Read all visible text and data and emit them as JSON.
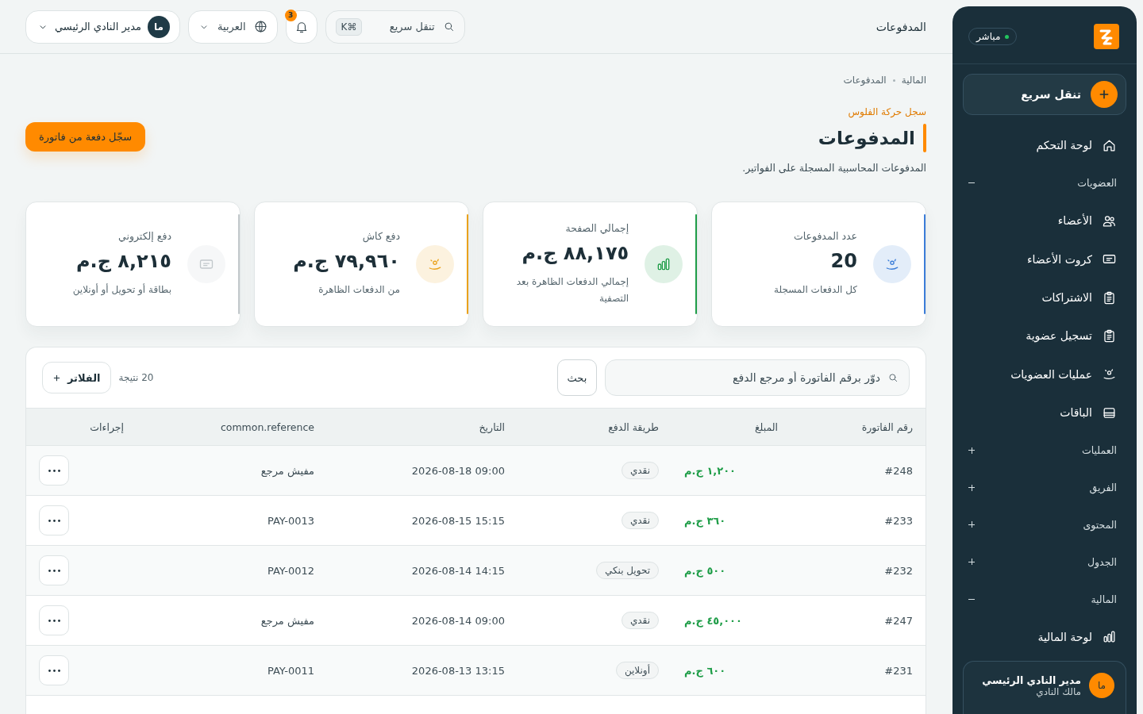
{
  "sidebar": {
    "live_label": "مباشر",
    "quick_nav": "تنقل سريع",
    "nav": [
      {
        "kind": "link",
        "label": "لوحة التحكم"
      },
      {
        "kind": "section",
        "label": "العضويات",
        "expanded": true,
        "children": [
          {
            "kind": "link",
            "label": "الأعضاء"
          },
          {
            "kind": "link",
            "label": "كروت الأعضاء"
          },
          {
            "kind": "link",
            "label": "الاشتراكات"
          },
          {
            "kind": "link",
            "label": "تسجيل عضوية"
          },
          {
            "kind": "link",
            "label": "عمليات العضويات"
          },
          {
            "kind": "link",
            "label": "الباقات"
          }
        ]
      },
      {
        "kind": "section",
        "label": "العمليات",
        "expanded": false
      },
      {
        "kind": "section",
        "label": "الفريق",
        "expanded": false
      },
      {
        "kind": "section",
        "label": "المحتوى",
        "expanded": false
      },
      {
        "kind": "section",
        "label": "الجدول",
        "expanded": false
      },
      {
        "kind": "section",
        "label": "المالية",
        "expanded": true,
        "children": [
          {
            "kind": "link",
            "label": "لوحة المالية"
          }
        ]
      }
    ],
    "user": {
      "avatar": "ما",
      "name": "مدير النادي الرئيسي",
      "role": "مالك النادي"
    }
  },
  "topbar": {
    "title": "المدفوعات",
    "quick_nav": "تنقل سريع",
    "shortcut": "⌘K",
    "notification_count": "3",
    "language": "العربية",
    "user": {
      "avatar": "ما",
      "name": "مدير النادي الرئيسي"
    }
  },
  "header": {
    "breadcrumb": [
      "المالية",
      "المدفوعات"
    ],
    "eyebrow": "سجل حركة الفلوس",
    "title": "المدفوعات",
    "description": "المدفوعات المحاسبية المسجلة على الفواتير.",
    "action": "سجّل دفعة من فاتورة"
  },
  "stats": [
    {
      "label": "عدد المدفوعات",
      "value": "20",
      "note": "كل الدفعات المسجلة",
      "color": "#3b7dd8"
    },
    {
      "label": "إجمالي الصفحة",
      "value": "٨٨,١٧٥ ج.م",
      "note": "إجمالي الدفعات الظاهرة بعد التصفية",
      "color": "#1f9d48"
    },
    {
      "label": "دفع كاش",
      "value": "٧٩,٩٦٠ ج.م",
      "note": "من الدفعات الظاهرة",
      "color": "#eaa21c"
    },
    {
      "label": "دفع إلكتروني",
      "value": "٨,٢١٥ ج.م",
      "note": "بطاقة أو تحويل أو أونلاين",
      "color": "#c2c8cb"
    }
  ],
  "table": {
    "search": {
      "placeholder": "دوّر برقم الفاتورة أو مرجع الدفع"
    },
    "search_button": "بحث",
    "result_count": "20 نتيجة",
    "filters_button": "الفلاتر",
    "columns": [
      "رقم الفاتورة",
      "المبلغ",
      "طريقة الدفع",
      "التاريخ",
      "common.reference",
      "إجراءات"
    ],
    "rows": [
      {
        "invoice": "#248",
        "amount": "١,٢٠٠ ج.م",
        "method": "نقدي",
        "date": "2026-08-18 09:00",
        "reference": "مفيش مرجع"
      },
      {
        "invoice": "#233",
        "amount": "٣٦٠ ج.م",
        "method": "نقدي",
        "date": "2026-08-15 15:15",
        "reference": "PAY-0013"
      },
      {
        "invoice": "#232",
        "amount": "٥٠٠ ج.م",
        "method": "تحويل بنكي",
        "date": "2026-08-14 14:15",
        "reference": "PAY-0012"
      },
      {
        "invoice": "#247",
        "amount": "٤٥,٠٠٠ ج.م",
        "method": "نقدي",
        "date": "2026-08-14 09:00",
        "reference": "مفيش مرجع"
      },
      {
        "invoice": "#231",
        "amount": "٦٠٠ ج.م",
        "method": "أونلاين",
        "date": "2026-08-13 13:15",
        "reference": "PAY-0011"
      }
    ]
  }
}
